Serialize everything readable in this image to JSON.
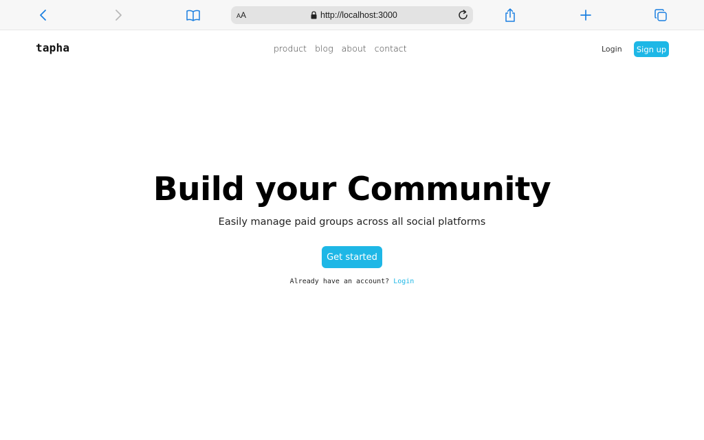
{
  "browser": {
    "reader_small": "A",
    "reader_big": "A",
    "url": "http://localhost:3000",
    "accent_color": "#1a7fe0"
  },
  "header": {
    "logo": "tapha",
    "nav": [
      "product",
      "blog",
      "about",
      "contact"
    ],
    "login_label": "Login",
    "signup_label": "Sign up"
  },
  "hero": {
    "title": "Build your Community",
    "subtitle": "Easily manage paid groups across all social platforms",
    "cta_label": "Get started",
    "account_prompt": "Already have an account?",
    "account_login": "Login"
  },
  "colors": {
    "brand": "#1eb7e6",
    "text": "#111111",
    "background": "#ffffff"
  }
}
